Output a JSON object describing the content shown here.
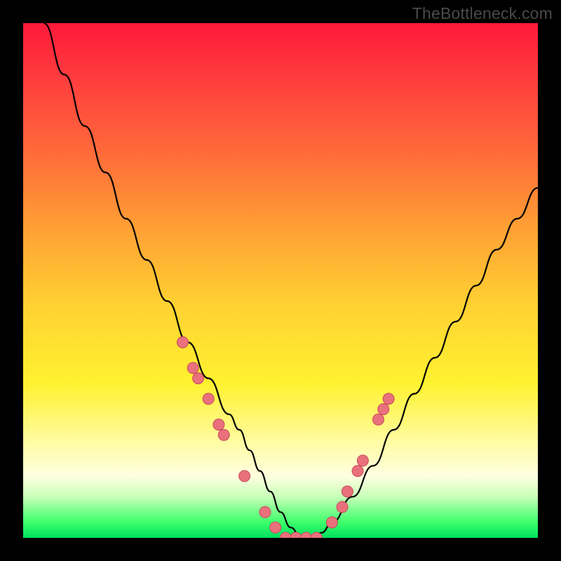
{
  "watermark": "TheBottleneck.com",
  "chart_data": {
    "type": "line",
    "title": "",
    "xlabel": "",
    "ylabel": "",
    "xlim": [
      0,
      100
    ],
    "ylim": [
      0,
      100
    ],
    "series": [
      {
        "name": "bottleneck-curve",
        "x": [
          4,
          8,
          12,
          16,
          20,
          24,
          28,
          32,
          36,
          40,
          42,
          44,
          46,
          48,
          50,
          52,
          54,
          56,
          58,
          60,
          64,
          68,
          72,
          76,
          80,
          84,
          88,
          92,
          96,
          100
        ],
        "y": [
          100,
          90,
          80,
          71,
          62,
          54,
          46,
          38,
          31,
          24,
          21,
          17,
          13,
          9,
          5,
          2,
          0,
          0,
          1,
          3,
          8,
          14,
          21,
          28,
          35,
          42,
          49,
          56,
          62,
          68
        ]
      }
    ],
    "markers": {
      "name": "scatter-points",
      "points": [
        {
          "x": 31,
          "y": 38
        },
        {
          "x": 33,
          "y": 33
        },
        {
          "x": 34,
          "y": 31
        },
        {
          "x": 36,
          "y": 27
        },
        {
          "x": 38,
          "y": 22
        },
        {
          "x": 39,
          "y": 20
        },
        {
          "x": 43,
          "y": 12
        },
        {
          "x": 47,
          "y": 5
        },
        {
          "x": 49,
          "y": 2
        },
        {
          "x": 51,
          "y": 0
        },
        {
          "x": 53,
          "y": 0
        },
        {
          "x": 55,
          "y": 0
        },
        {
          "x": 57,
          "y": 0
        },
        {
          "x": 60,
          "y": 3
        },
        {
          "x": 62,
          "y": 6
        },
        {
          "x": 63,
          "y": 9
        },
        {
          "x": 65,
          "y": 13
        },
        {
          "x": 66,
          "y": 15
        },
        {
          "x": 69,
          "y": 23
        },
        {
          "x": 70,
          "y": 25
        },
        {
          "x": 71,
          "y": 27
        }
      ]
    },
    "colors": {
      "curve": "#000000",
      "markers_fill": "#e9717c",
      "markers_stroke": "#c94a5a",
      "gradient_top": "#ff1a3a",
      "gradient_bottom": "#00e060"
    }
  }
}
